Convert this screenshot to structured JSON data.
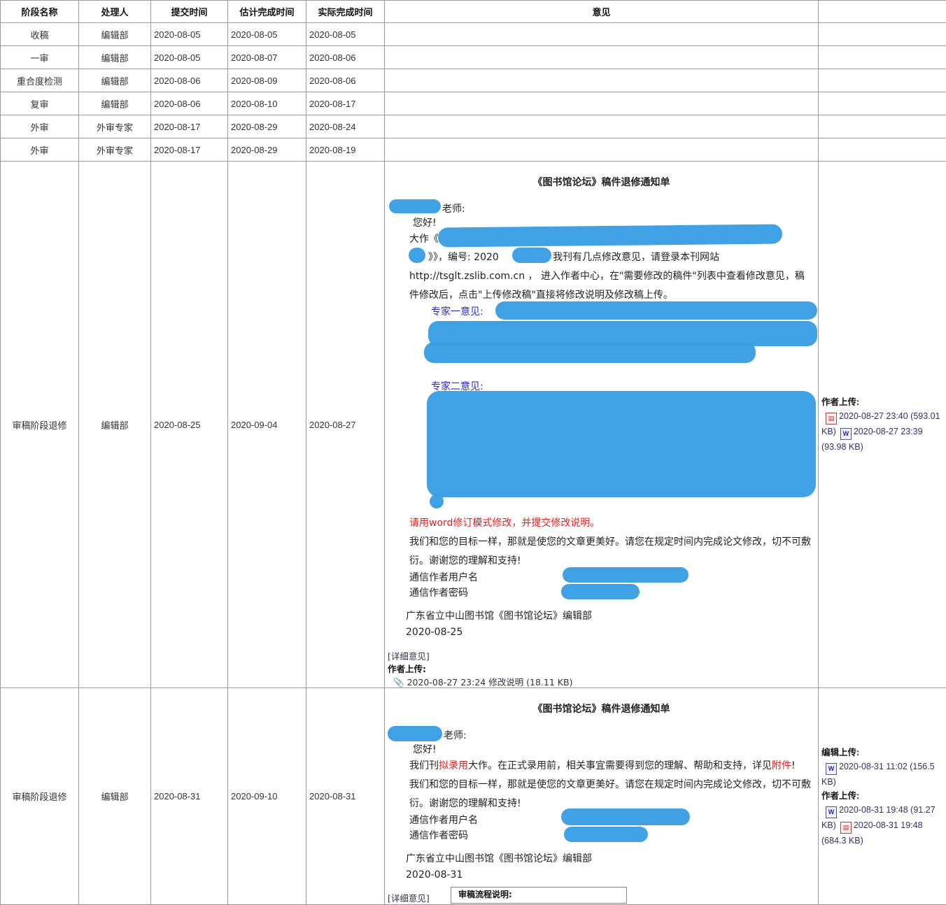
{
  "headers": [
    "阶段名称",
    "处理人",
    "提交时间",
    "估计完成时间",
    "实际完成时间",
    "意见",
    ""
  ],
  "rows": [
    {
      "stage": "收稿",
      "handler": "编辑部",
      "submit": "2020-08-05",
      "est": "2020-08-05",
      "actual": "2020-08-05"
    },
    {
      "stage": "一审",
      "handler": "编辑部",
      "submit": "2020-08-05",
      "est": "2020-08-07",
      "actual": "2020-08-06"
    },
    {
      "stage": "重合度检测",
      "handler": "编辑部",
      "submit": "2020-08-06",
      "est": "2020-08-09",
      "actual": "2020-08-06"
    },
    {
      "stage": "复审",
      "handler": "编辑部",
      "submit": "2020-08-06",
      "est": "2020-08-10",
      "actual": "2020-08-17"
    },
    {
      "stage": "外审",
      "handler": "外审专家",
      "submit": "2020-08-17",
      "est": "2020-08-29",
      "actual": "2020-08-24"
    },
    {
      "stage": "外审",
      "handler": "外审专家",
      "submit": "2020-08-17",
      "est": "2020-08-29",
      "actual": "2020-08-19"
    }
  ],
  "big1": {
    "stage": "审稿阶段退修",
    "handler": "编辑部",
    "submit": "2020-08-25",
    "est": "2020-09-04",
    "actual": "2020-08-27",
    "title": "《图书馆论坛》稿件退修通知单",
    "salutation": "老师:",
    "greeting": "您好!",
    "line1": "大作《",
    "line2a": "》》，编号: 2020",
    "line2b": "我刊有几点修改意见，请登录本刊网站",
    "line3": "http://tsglt.zslib.com.cn ， 进入作者中心，在\"需要修改的稿件\"列表中查看修改意见，稿",
    "line4": "件修改后，点击\"上传修改稿\"直接将修改说明及修改稿上传。",
    "expert1": "专家一意见:",
    "expert2": "专家二意见:",
    "red": "请用word修订模式修改，并提交修改说明。",
    "goal1": "我们和您的目标一样，那就是使您的文章更美好。请您在规定时间内完成论文修改，切不可敷",
    "goal2": "衍。谢谢您的理解和支持!",
    "user": "通信作者用户名",
    "pass": "通信作者密码",
    "sign": "广东省立中山图书馆《图书馆论坛》编辑部",
    "date": "2020-08-25",
    "detail": "[详细意见]",
    "author_upload": "作者上传:",
    "upload_file": "2020-08-27 23:24 修改说明 (18.11 KB)",
    "side_label": "作者上传:",
    "side_f1a": "2020-08-27 23:40 (593.01",
    "side_f1b": "KB)",
    "side_f2a": "2020-08-27 23:39",
    "side_f2b": "(93.98 KB)"
  },
  "big2": {
    "stage": "审稿阶段退修",
    "handler": "编辑部",
    "submit": "2020-08-31",
    "est": "2020-09-10",
    "actual": "2020-08-31",
    "title": "《图书馆论坛》稿件退修通知单",
    "salutation": "老师:",
    "greeting": "您好!",
    "l1a": "我们刊",
    "l1b": "拟录用",
    "l1c": "大作。在正式录用前，相关事宜需要得到您的理解、帮助和支持，详见",
    "l1d": "附件",
    "l1e": "!",
    "goal1": "我们和您的目标一样，那就是使您的文章更美好。请您在规定时间内完成论文修改，切不可敷",
    "goal2": "衍。谢谢您的理解和支持!",
    "user": "通信作者用户名",
    "pass": "通信作者密码",
    "sign": "广东省立中山图书馆《图书馆论坛》编辑部",
    "date": "2020-08-31",
    "detail": "[详细意见]",
    "tooltip": "审稿流程说明:",
    "ed_label": "编辑上传:",
    "ed_f1a": "2020-08-31 11:02 (156.5",
    "ed_f1b": "KB)",
    "au_label": "作者上传:",
    "au_f1a": "2020-08-31 19:48 (91.27",
    "au_f1b": "KB)",
    "au_f2a": "2020-08-31 19:48",
    "au_f2b": "(684.3 KB)"
  }
}
